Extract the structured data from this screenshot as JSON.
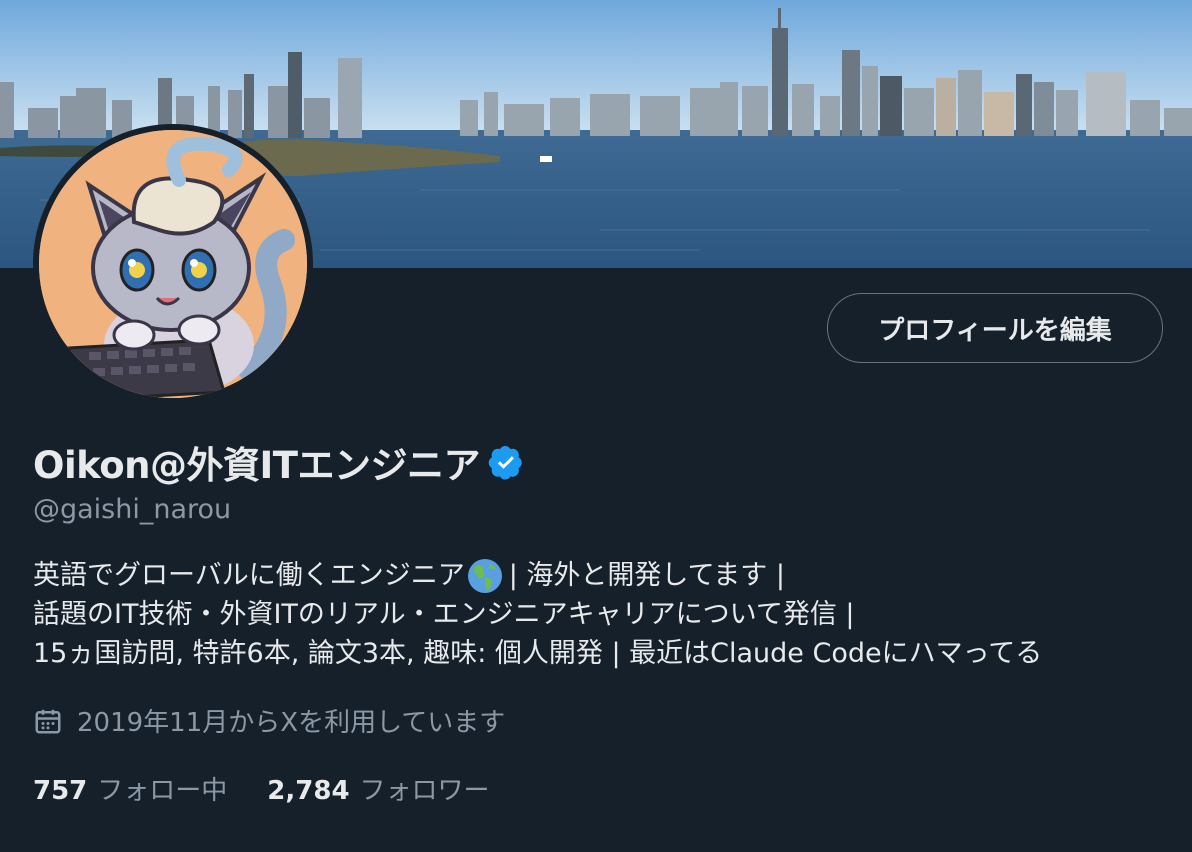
{
  "profile": {
    "edit_button": "プロフィールを編集",
    "display_name": "Oikon@外資ITエンジニア",
    "handle": "@gaishi_narou",
    "bio": {
      "line1_a": "英語でグローバルに働くエンジニア",
      "line1_b": "| 海外と開発してます |",
      "line2": "話題のIT技術・外資ITのリアル・エンジニアキャリアについて発信 |",
      "line3": "15ヵ国訪問, 特許6本, 論文3本, 趣味: 個人開発 | 最近はClaude Codeにハマってる"
    },
    "joined": "2019年11月からXを利用しています",
    "stats": {
      "following_count": "757",
      "following_label": "フォロー中",
      "followers_count": "2,784",
      "followers_label": "フォロワー"
    }
  },
  "icons": {
    "verified": "verified-badge-icon",
    "globe": "globe-americas-emoji-icon",
    "calendar": "calendar-icon"
  },
  "colors": {
    "background": "#15202b",
    "verified": "#1d9bf0",
    "muted_text": "#8b98a5",
    "text": "#e7e9ea"
  }
}
